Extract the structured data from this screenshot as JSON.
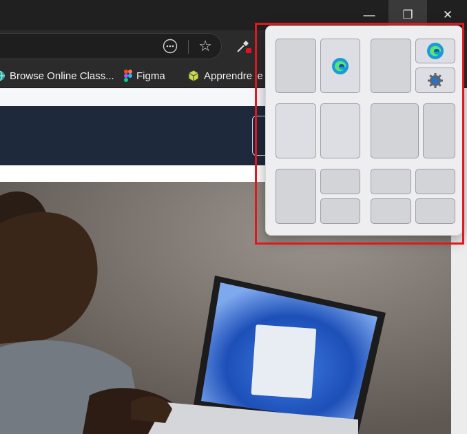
{
  "window_controls": {
    "minimize_glyph": "—",
    "maximize_glyph": "❐",
    "close_glyph": "✕"
  },
  "toolbar": {
    "more_glyph": "⋯",
    "favorite_glyph": "☆",
    "extension_badge_color": "#e81123"
  },
  "favorites": [
    {
      "label": "Browse Online Class...",
      "icon": "globe-icon"
    },
    {
      "label": "Figma",
      "icon": "figma-icon"
    },
    {
      "label": "Apprendre le",
      "icon": "cube-icon"
    }
  ],
  "snap_layouts": {
    "highlight_color": "#e0171e",
    "layouts": [
      {
        "name": "two-equal",
        "zones": 2,
        "apps": [
          "",
          "edge"
        ]
      },
      {
        "name": "main-plus-two",
        "zones": 3,
        "apps": [
          "",
          "edge",
          "settings"
        ]
      },
      {
        "name": "two-equal-alt",
        "zones": 2,
        "apps": [
          "",
          ""
        ]
      },
      {
        "name": "wide-narrow",
        "zones": 2,
        "apps": [
          "",
          ""
        ]
      },
      {
        "name": "left-plus-two",
        "zones": 3,
        "apps": [
          "",
          "",
          ""
        ]
      },
      {
        "name": "grid-four",
        "zones": 4,
        "apps": [
          "",
          "",
          "",
          ""
        ]
      }
    ]
  }
}
